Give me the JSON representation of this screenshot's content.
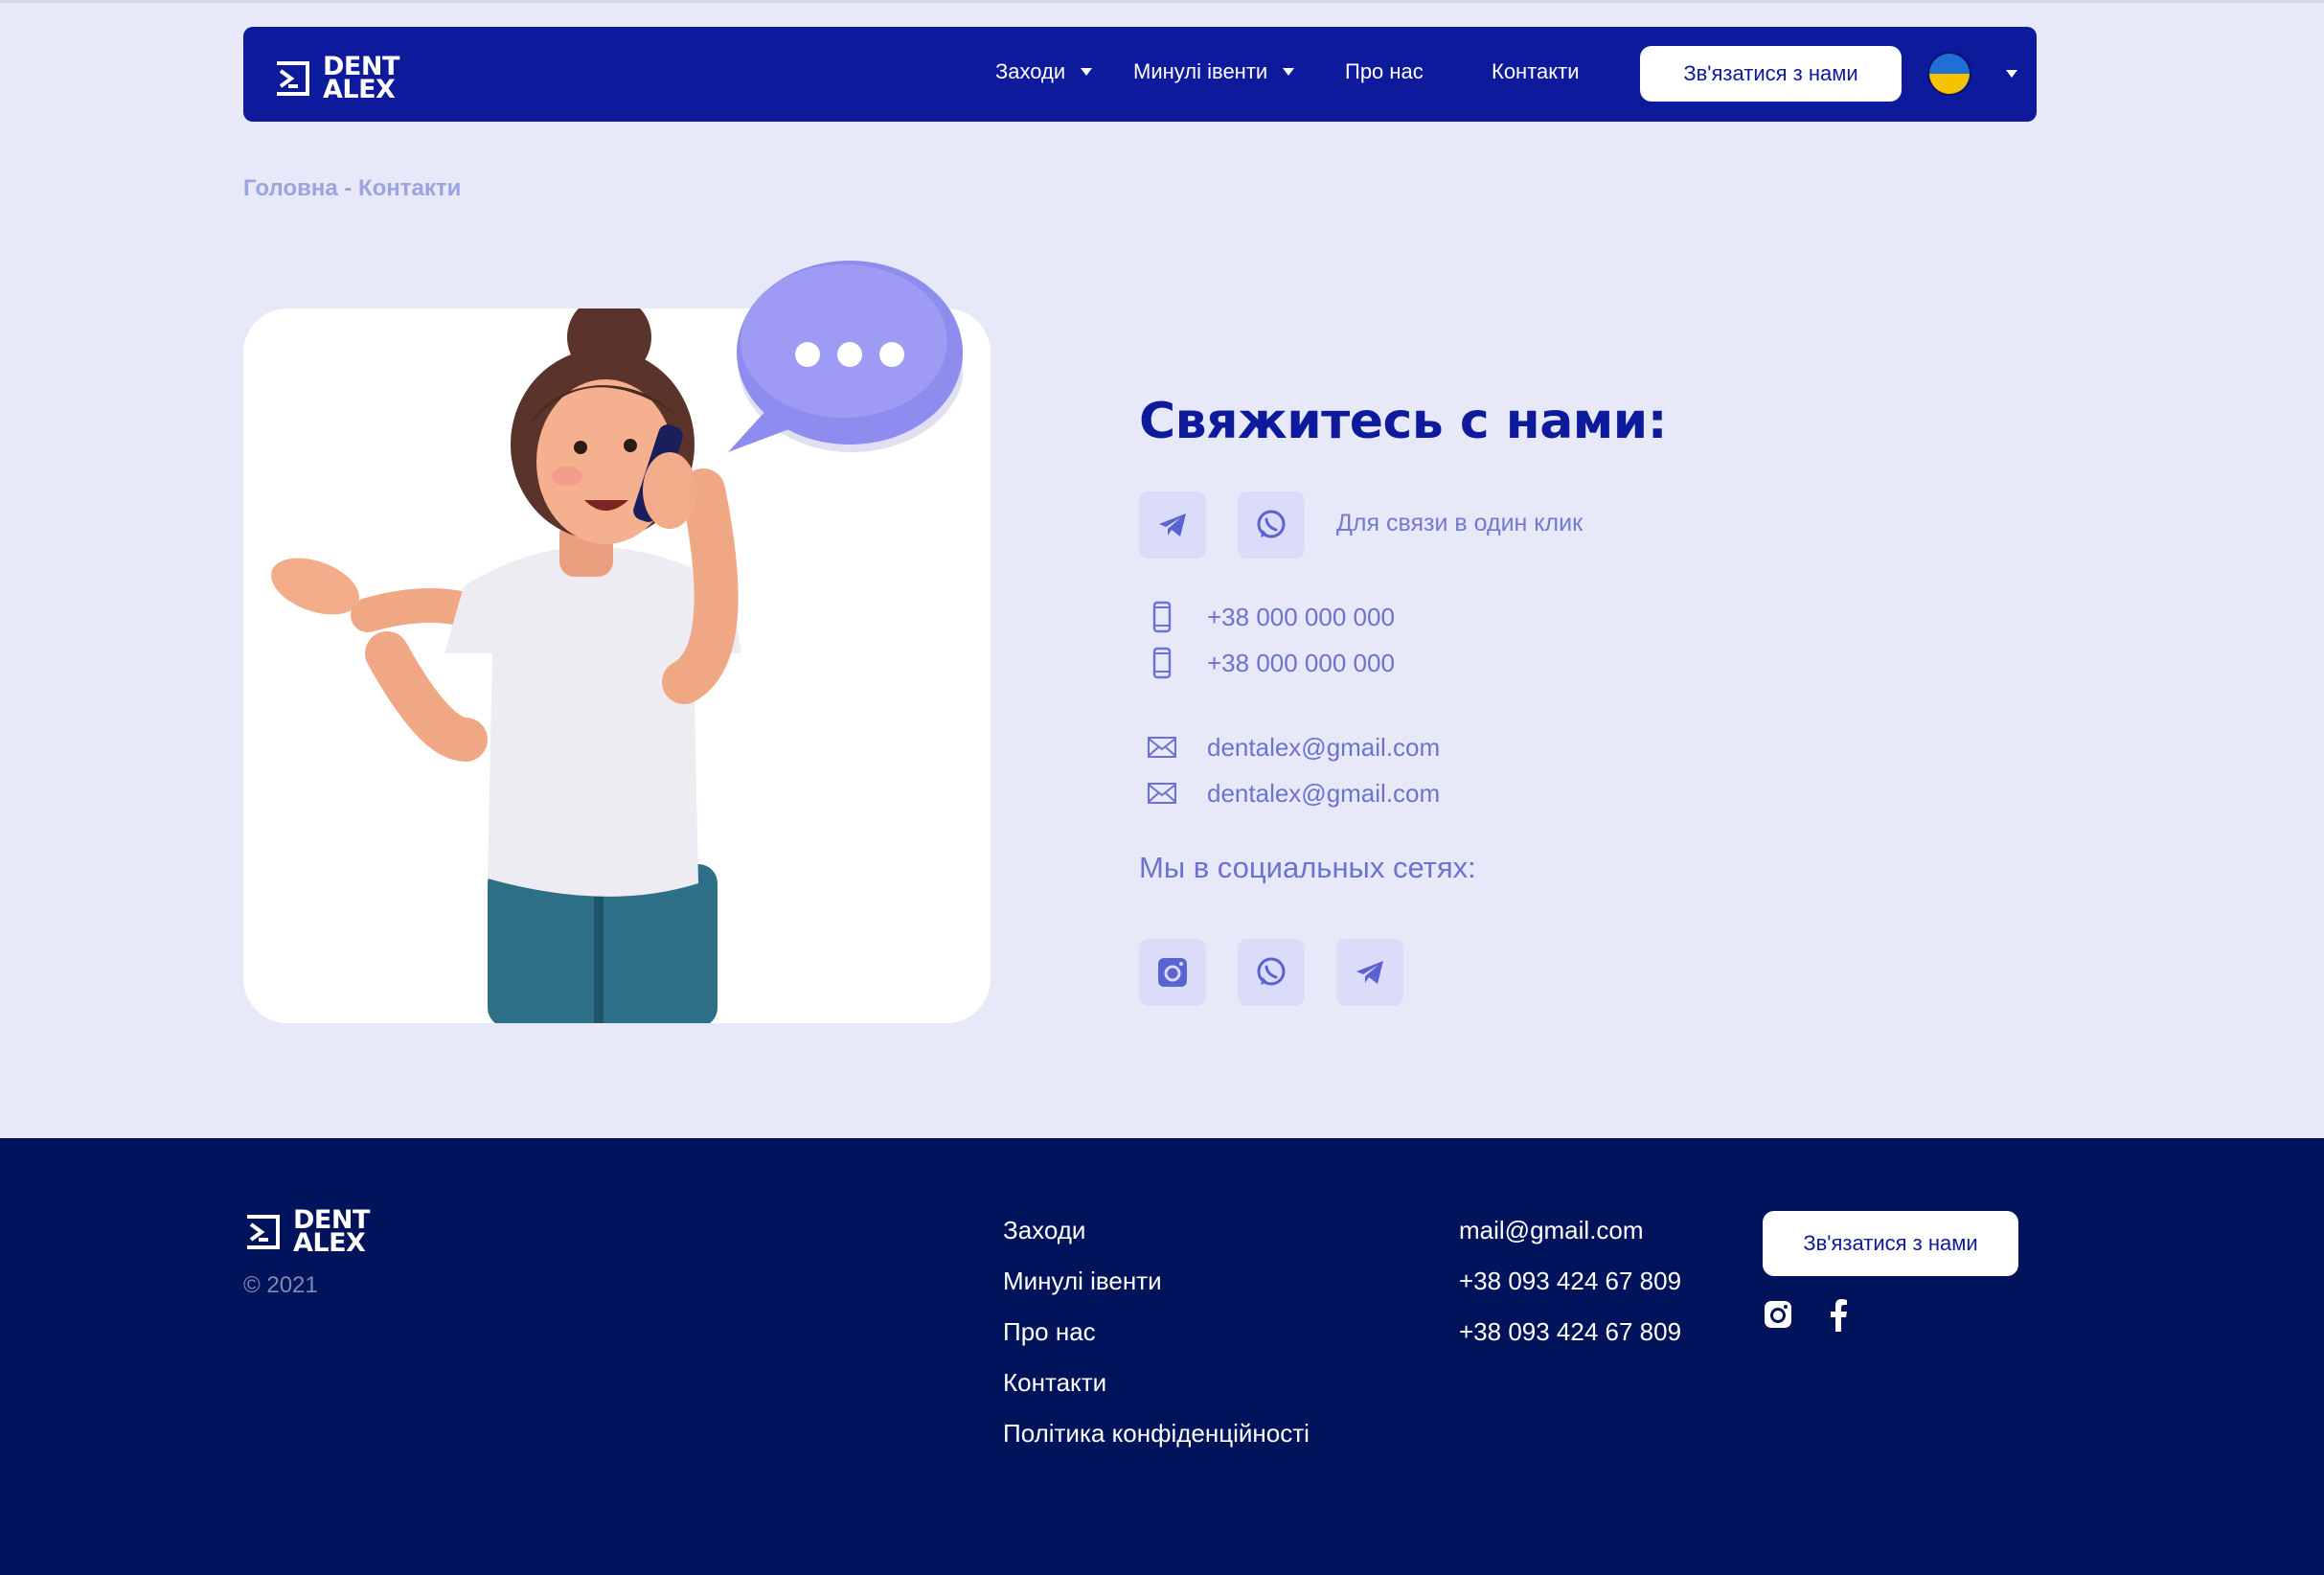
{
  "brand": {
    "logo_line1": "DENT",
    "logo_line2": "ALEX"
  },
  "nav": {
    "items": [
      {
        "label": "Заходи",
        "has_dropdown": true
      },
      {
        "label": "Минулі івенти",
        "has_dropdown": true
      },
      {
        "label": "Про нас",
        "has_dropdown": false
      },
      {
        "label": "Контакти",
        "has_dropdown": false
      }
    ],
    "cta_label": "Зв'язатися з нами",
    "language_icon": "ukraine-flag-icon"
  },
  "breadcrumb": "Головна - Контакти",
  "contact": {
    "heading": "Свяжитесь с нами:",
    "quick_icons": [
      "telegram-icon",
      "whatsapp-icon"
    ],
    "quick_text": "Для связи в один клик",
    "phones": [
      "+38 000 000 000",
      "+38 000 000 000"
    ],
    "emails": [
      "dentalex@gmail.com",
      "dentalex@gmail.com"
    ],
    "social_title": "Мы в социальных сетях:",
    "social_icons": [
      "instagram-icon",
      "whatsapp-icon",
      "telegram-icon"
    ]
  },
  "footer": {
    "copyright": "© 2021",
    "links": [
      "Заходи",
      "Минулі івенти",
      "Про нас",
      "Контакти",
      "Політика конфіденційності"
    ],
    "email": "mail@gmail.com",
    "phones": [
      "+38 093 424 67 809",
      "+38 093 424 67 809"
    ],
    "cta_label": "Зв'язатися з нами",
    "social_icons": [
      "instagram-icon",
      "facebook-icon"
    ]
  },
  "colors": {
    "page_bg": "#e7e9f8",
    "nav_bg": "#0d1a9c",
    "footer_bg": "#01135a",
    "accent_text": "#6b72cf",
    "icon_tile": "#dadcfa"
  }
}
